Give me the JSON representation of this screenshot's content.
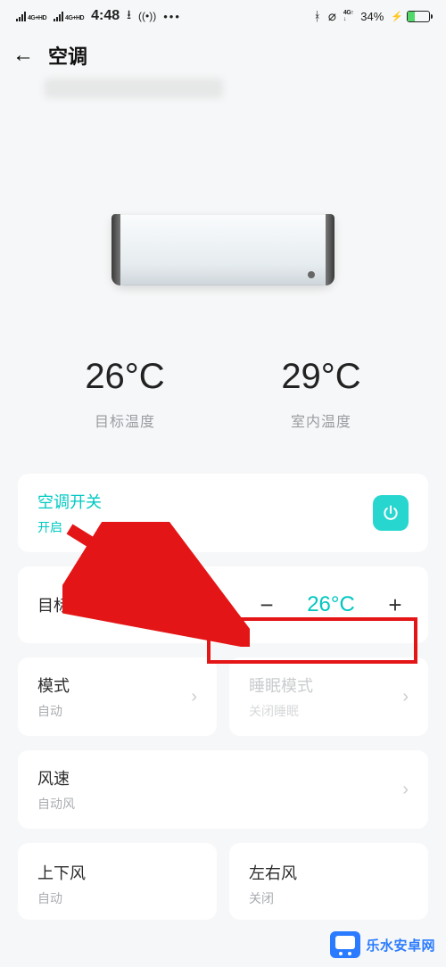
{
  "status": {
    "net_label": "4G+HD",
    "time": "4:48",
    "bluetooth": "✱",
    "battery_pct": "34%"
  },
  "header": {
    "title": "空调"
  },
  "temperature": {
    "target": {
      "value": "26°C",
      "label": "目标温度"
    },
    "room": {
      "value": "29°C",
      "label": "室内温度"
    }
  },
  "cards": {
    "power": {
      "title": "空调开关",
      "status": "开启"
    },
    "target": {
      "title": "目标温度",
      "value": "26°C"
    },
    "mode": {
      "title": "模式",
      "status": "自动"
    },
    "sleep": {
      "title": "睡眠模式",
      "status": "关闭睡眠"
    },
    "fan": {
      "title": "风速",
      "status": "自动风"
    },
    "swingV": {
      "title": "上下风",
      "status": "自动"
    },
    "swingH": {
      "title": "左右风",
      "status": "关闭"
    }
  },
  "watermark": {
    "text": "乐水安卓网"
  }
}
